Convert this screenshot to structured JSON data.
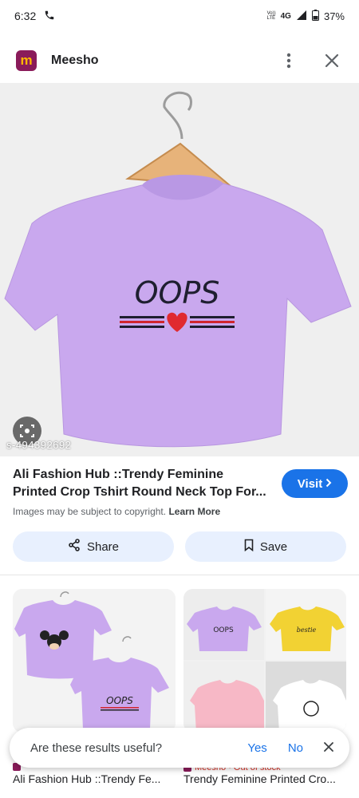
{
  "status_bar": {
    "time": "6:32",
    "net_top": "Vo))",
    "net_bottom": "LTE",
    "network": "4G",
    "battery": "37%"
  },
  "app": {
    "name": "Meesho",
    "logo_letter": "m"
  },
  "hero": {
    "print_text": "OOPS",
    "watermark": "s-494392692"
  },
  "product": {
    "title": "Ali Fashion Hub ::Trendy Feminine Printed Crop Tshirt Round Neck Top For...",
    "visit_label": "Visit",
    "copyright_text": "Images may be subject to copyright.",
    "learn_more": "Learn More"
  },
  "actions": {
    "share_label": "Share",
    "save_label": "Save"
  },
  "related": [
    {
      "print_text": "OOPS",
      "source": "",
      "title": "Ali Fashion Hub ::Trendy Fe..."
    },
    {
      "print_oops": "OOPS",
      "print_script": "bestie",
      "source": "Meesho · Out of stock",
      "title": "Trendy Feminine Printed Cro..."
    }
  ],
  "feedback": {
    "question": "Are these results useful?",
    "yes": "Yes",
    "no": "No"
  },
  "colors": {
    "accent": "#1a73e8",
    "shirt": "#c9a8ee",
    "logo_bg": "#8a1b5a",
    "out_of_stock": "#d93025"
  }
}
